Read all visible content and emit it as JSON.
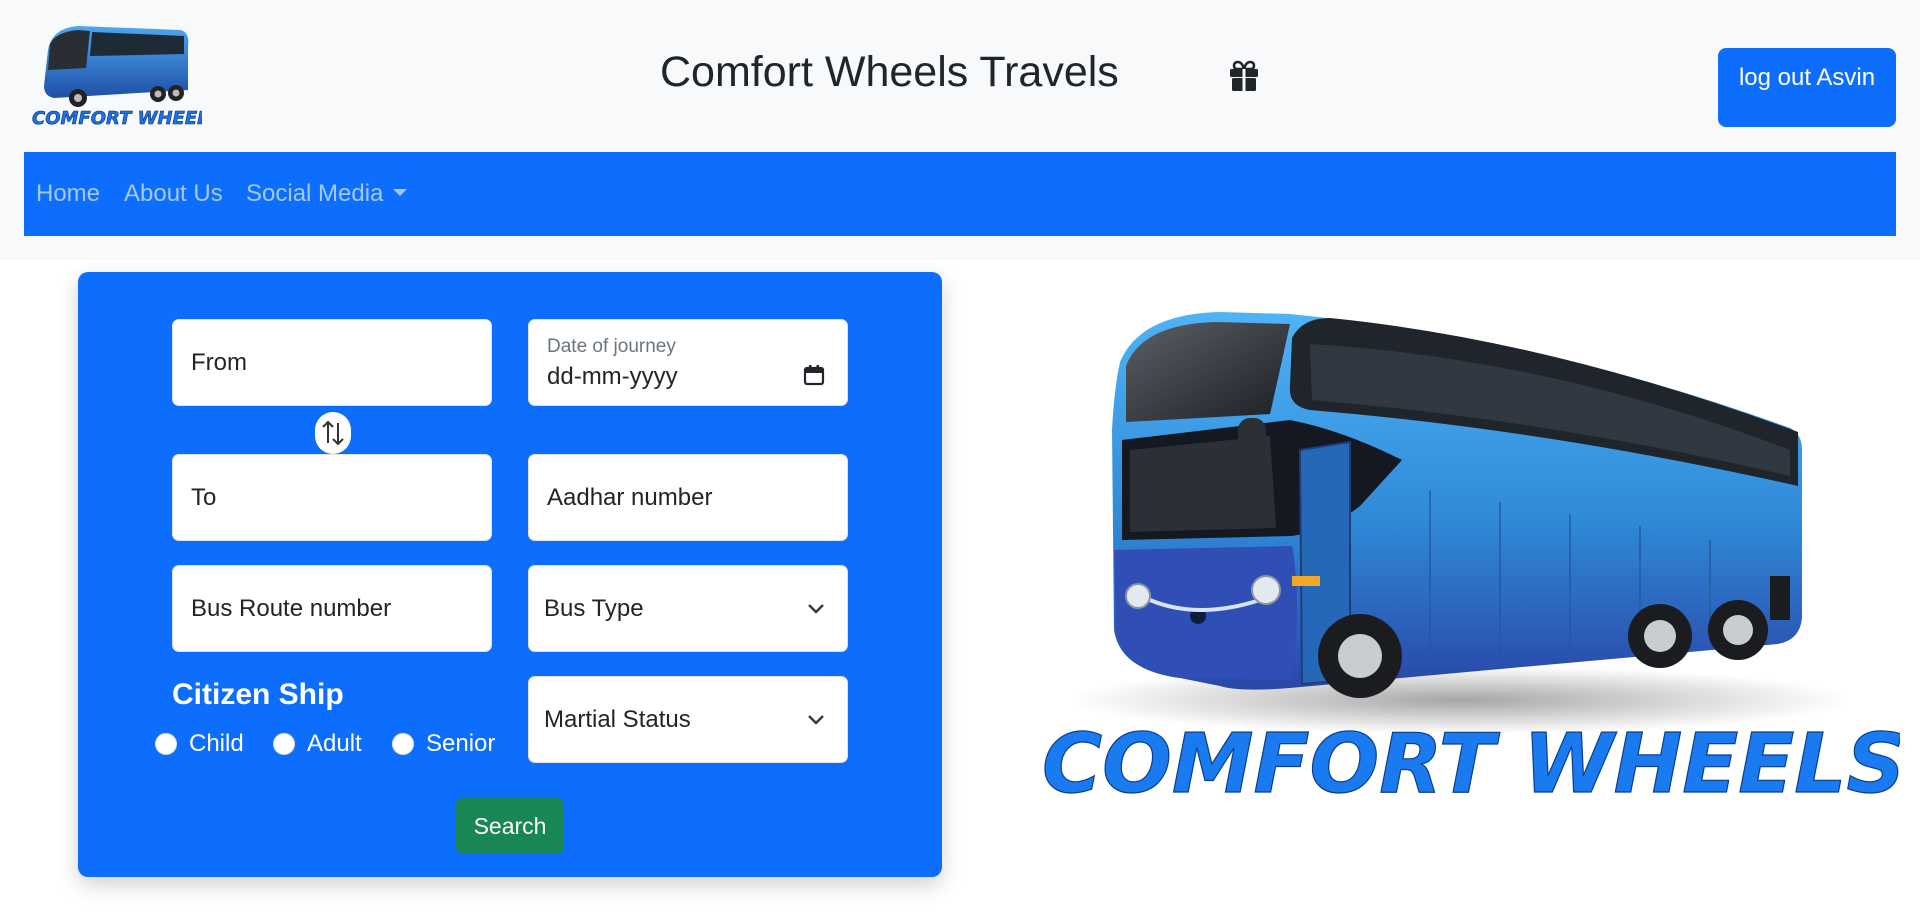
{
  "header": {
    "title": "Comfort Wheels Travels",
    "logout_label": "log out Asvin",
    "logo_text": "COMFORT WHEELS"
  },
  "nav": {
    "items": [
      {
        "label": "Home"
      },
      {
        "label": "About Us"
      },
      {
        "label": "Social Media",
        "dropdown": true
      }
    ]
  },
  "form": {
    "from_placeholder": "From",
    "to_placeholder": "To",
    "date_label": "Date of journey",
    "date_value": "dd-mm-yyyy",
    "aadhar_placeholder": "Aadhar number",
    "route_placeholder": "Bus Route number",
    "bus_type_selected": "Bus Type",
    "marital_selected": "Martial Status",
    "citizenship_label": "Citizen Ship",
    "citizenship_options": [
      "Child",
      "Adult",
      "Senior"
    ],
    "search_label": "Search"
  },
  "hero": {
    "logo_text": "COMFORT WHEELS"
  },
  "colors": {
    "primary": "#0d6efd",
    "success": "#198754",
    "header_bg": "#f8f9fa"
  },
  "icons": [
    "gift-icon",
    "swap-arrows-icon",
    "calendar-icon",
    "chevron-down-icon"
  ]
}
